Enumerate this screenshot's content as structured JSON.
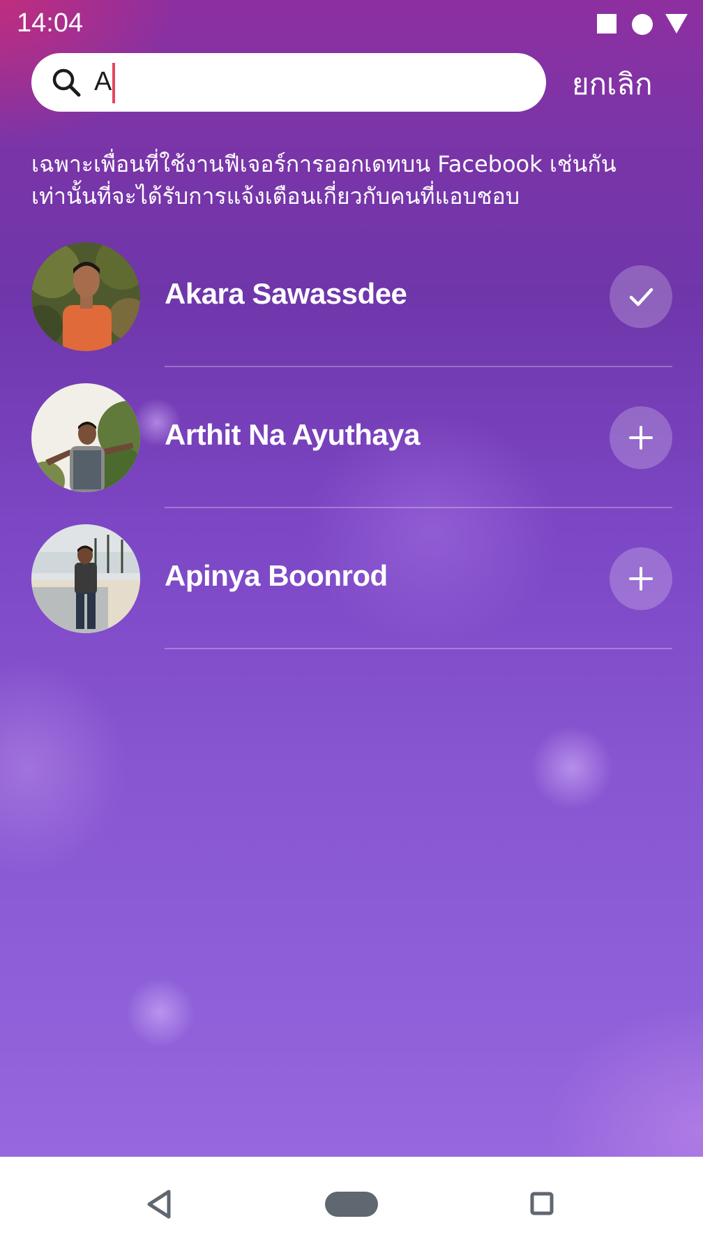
{
  "status_bar": {
    "time": "14:04"
  },
  "search": {
    "value": "A",
    "cancel_label": "ยกเลิก"
  },
  "info": {
    "text": "เฉพาะเพื่อนที่ใช้งานฟีเจอร์การออกเดทบน Facebook เช่นกันเท่านั้นที่จะได้รับการแจ้งเตือนเกี่ยวกับคนที่แอบชอบ"
  },
  "friends": [
    {
      "name": "Akara Sawassdee",
      "action": "check-icon",
      "selected": true
    },
    {
      "name": "Arthit Na Ayuthaya",
      "action": "plus-icon",
      "selected": false
    },
    {
      "name": "Apinya Boonrod",
      "action": "plus-icon",
      "selected": false
    }
  ],
  "nav": {
    "icons": [
      "back-icon",
      "home-icon",
      "recents-icon"
    ]
  },
  "colors": {
    "accent_caret": "#e8455e",
    "background_top": "#8e2fa0",
    "background_bottom": "#9668de"
  }
}
